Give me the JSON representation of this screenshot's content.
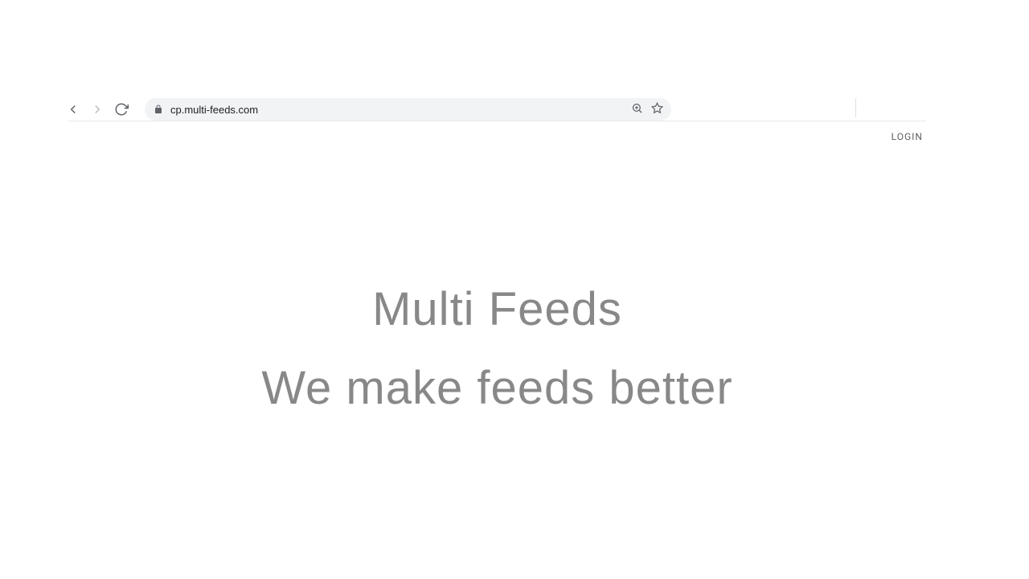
{
  "browser": {
    "url": "cp.multi-feeds.com"
  },
  "header": {
    "login_label": "LOGIN"
  },
  "hero": {
    "title": "Multi Feeds",
    "subtitle": "We make feeds better"
  }
}
